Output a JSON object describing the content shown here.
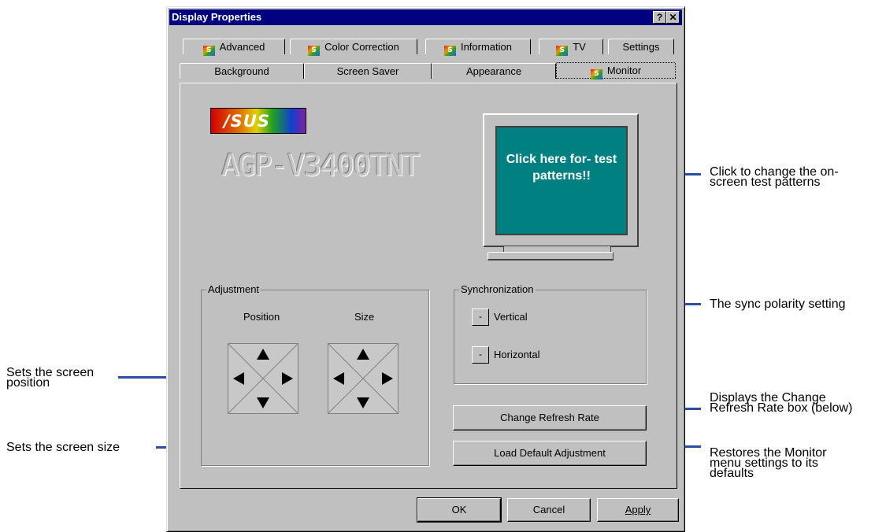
{
  "window": {
    "title": "Display Properties",
    "help_button": "?",
    "close_button": "✕"
  },
  "tabs_top": [
    {
      "label": "Advanced",
      "icon": "asus-icon"
    },
    {
      "label": "Color Correction",
      "icon": "asus-icon"
    },
    {
      "label": "Information",
      "icon": "asus-icon"
    },
    {
      "label": "TV",
      "icon": "asus-icon"
    },
    {
      "label": "Settings"
    }
  ],
  "tabs_bottom": [
    {
      "label": "Background"
    },
    {
      "label": "Screen Saver"
    },
    {
      "label": "Appearance"
    },
    {
      "label": "Monitor",
      "icon": "asus-icon",
      "active": true
    }
  ],
  "monitor_tab": {
    "logo_text": "/SUS",
    "model_name": "AGP-V3400TNT",
    "test_screen_text": "Click here for- test patterns!!",
    "adjustment": {
      "title": "Adjustment",
      "position_label": "Position",
      "size_label": "Size"
    },
    "synchronization": {
      "title": "Synchronization",
      "vertical_label": "Vertical",
      "horizontal_label": "Horizontal",
      "vertical_button": "-",
      "horizontal_button": "-"
    },
    "change_refresh_rate_button": "Change Refresh Rate",
    "load_default_button": "Load Default Adjustment"
  },
  "footer_buttons": {
    "ok": "OK",
    "cancel": "Cancel",
    "apply": "Apply"
  },
  "annotations": {
    "test_patterns": "Click to change the on- screen test patterns",
    "sync": "The sync polarity setting",
    "position": "Sets the screen position",
    "size": "Sets the screen size",
    "refresh": "Displays the Change Refresh Rate box (below)",
    "defaults": "Restores the Monitor menu settings to its defaults"
  },
  "colors": {
    "title_bar": "#000080",
    "window_face": "#c0c0c0",
    "screen_teal": "#008080",
    "annotation_line": "#2a4fa6"
  }
}
